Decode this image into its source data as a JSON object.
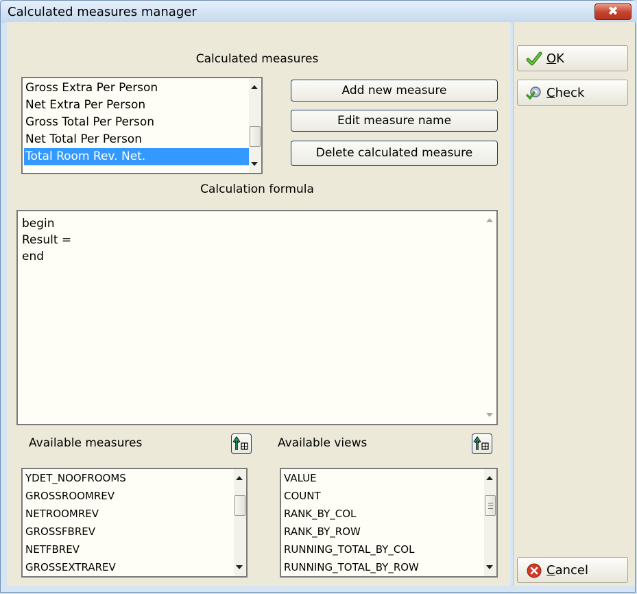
{
  "window": {
    "title": "Calculated measures manager",
    "close_symbol": "✖"
  },
  "calculated_measures": {
    "label": "Calculated measures",
    "items": [
      "Gross Extra Per Person",
      "Net Extra Per Person",
      "Gross Total Per Person",
      "Net Total Per Person",
      "Total Room Rev. Net."
    ],
    "selected_index": 4,
    "buttons": {
      "add": "Add new measure",
      "edit": "Edit measure name",
      "delete": "Delete calculated measure"
    }
  },
  "formula": {
    "label": "Calculation formula",
    "lines": [
      "begin",
      "Result =",
      "end"
    ]
  },
  "available_measures": {
    "label": "Available measures",
    "items": [
      "YDET_NOOFROOMS",
      "GROSSROOMREV",
      "NETROOMREV",
      "GROSSFBREV",
      "NETFBREV",
      "GROSSEXTRAREV"
    ]
  },
  "available_views": {
    "label": "Available views",
    "items": [
      "VALUE",
      "COUNT",
      "RANK_BY_COL",
      "RANK_BY_ROW",
      "RUNNING_TOTAL_BY_COL",
      "RUNNING_TOTAL_BY_ROW"
    ]
  },
  "side": {
    "ok": {
      "mnemonic": "O",
      "rest": "K"
    },
    "check": {
      "mnemonic": "C",
      "rest": "heck"
    },
    "cancel": {
      "mnemonic": "C",
      "rest": "ancel"
    }
  },
  "colors": {
    "selection": "#3399ff",
    "ok_check": "#4aa62b",
    "cancel": "#d03a2a",
    "insert_arrow": "#2a9d6e"
  },
  "icons": [
    "close-icon",
    "ok-check-icon",
    "check-gear-icon",
    "cancel-icon",
    "insert-arrow-icon"
  ]
}
